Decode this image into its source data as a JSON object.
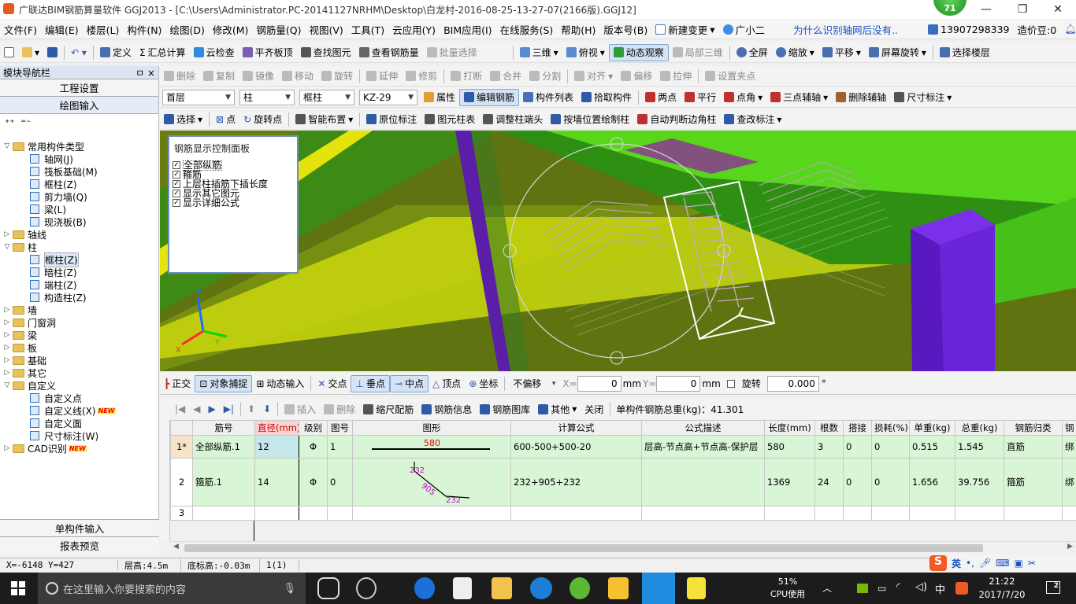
{
  "title": {
    "text": "广联达BIM钢筋算量软件 GGJ2013 - [C:\\Users\\Administrator.PC-20141127NRHM\\Desktop\\白龙村-2016-08-25-13-27-07(2166版).GGJ12]",
    "badge": "71"
  },
  "menu": {
    "items": [
      "文件(F)",
      "编辑(E)",
      "楼层(L)",
      "构件(N)",
      "绘图(D)",
      "修改(M)",
      "钢筋量(Q)",
      "视图(V)",
      "工具(T)",
      "云应用(Y)",
      "BIM应用(I)",
      "在线服务(S)",
      "帮助(H)",
      "版本号(B)"
    ],
    "new_change": "新建变更",
    "guangxiaoer": "广小二",
    "help_link": "为什么识别轴网后没有..",
    "phone": "13907298339",
    "cost_bean": "造价豆:0"
  },
  "toolbar1": {
    "define": "定义",
    "sum": "汇总计算",
    "cloud_check": "云检查",
    "align_slab": "平齐板顶",
    "find_elem": "查找图元",
    "view_rebar": "查看钢筋量",
    "batch_select": "批量选择",
    "view3d": "三维",
    "top_view": "俯视",
    "dynamic_view": "动态观察",
    "local3d": "局部三维",
    "fullscreen": "全屏",
    "zoom": "缩放",
    "pan": "平移",
    "rotate_screen": "屏幕旋转",
    "select_floor": "选择楼层"
  },
  "toolbar2": {
    "delete": "删除",
    "copy": "复制",
    "mirror": "镜像",
    "move": "移动",
    "rotate": "旋转",
    "extend": "延伸",
    "trim": "修剪",
    "break": "打断",
    "merge": "合并",
    "split": "分割",
    "align": "对齐",
    "offset": "偏移",
    "stretch": "拉伸",
    "set_grip": "设置夹点"
  },
  "toolbar3": {
    "floor": "首层",
    "type": "柱",
    "subtype": "框柱",
    "element": "KZ-29",
    "property": "属性",
    "edit_rebar": "编辑钢筋",
    "elem_list": "构件列表",
    "pick_elem": "拾取构件",
    "two_point": "两点",
    "parallel": "平行",
    "point_angle": "点角",
    "three_point_aux": "三点辅轴",
    "del_aux": "删除辅轴",
    "dimension": "尺寸标注"
  },
  "toolbar4": {
    "select": "选择",
    "point": "点",
    "rotate_point": "旋转点",
    "smart_layout": "智能布置",
    "origin_label": "原位标注",
    "elem_col_table": "图元柱表",
    "adjust_col_end": "调整柱端头",
    "draw_by_wall": "按墙位置绘制柱",
    "auto_corner": "自动判断边角柱",
    "change_label": "查改标注"
  },
  "nav": {
    "title": "模块导航栏",
    "pin": "ㅁ ×",
    "project_settings": "工程设置",
    "draw_input": "绘图输入",
    "single_input": "单构件输入",
    "report_preview": "报表预览",
    "tree": [
      {
        "label": "常用构件类型",
        "level": 0,
        "kind": "folder",
        "exp": "▽"
      },
      {
        "label": "轴网(J)",
        "level": 1,
        "kind": "item"
      },
      {
        "label": "筏板基础(M)",
        "level": 1,
        "kind": "item"
      },
      {
        "label": "框柱(Z)",
        "level": 1,
        "kind": "item"
      },
      {
        "label": "剪力墙(Q)",
        "level": 1,
        "kind": "item"
      },
      {
        "label": "梁(L)",
        "level": 1,
        "kind": "item"
      },
      {
        "label": "现浇板(B)",
        "level": 1,
        "kind": "item"
      },
      {
        "label": "轴线",
        "level": 0,
        "kind": "folder",
        "exp": "▷"
      },
      {
        "label": "柱",
        "level": 0,
        "kind": "folder",
        "exp": "▽"
      },
      {
        "label": "框柱(Z)",
        "level": 1,
        "kind": "item",
        "hl": true
      },
      {
        "label": "暗柱(Z)",
        "level": 1,
        "kind": "item"
      },
      {
        "label": "端柱(Z)",
        "level": 1,
        "kind": "item"
      },
      {
        "label": "构造柱(Z)",
        "level": 1,
        "kind": "item"
      },
      {
        "label": "墙",
        "level": 0,
        "kind": "folder",
        "exp": "▷"
      },
      {
        "label": "门窗洞",
        "level": 0,
        "kind": "folder",
        "exp": "▷"
      },
      {
        "label": "梁",
        "level": 0,
        "kind": "folder",
        "exp": "▷"
      },
      {
        "label": "板",
        "level": 0,
        "kind": "folder",
        "exp": "▷"
      },
      {
        "label": "基础",
        "level": 0,
        "kind": "folder",
        "exp": "▷"
      },
      {
        "label": "其它",
        "level": 0,
        "kind": "folder",
        "exp": "▷"
      },
      {
        "label": "自定义",
        "level": 0,
        "kind": "folder",
        "exp": "▽"
      },
      {
        "label": "自定义点",
        "level": 1,
        "kind": "item"
      },
      {
        "label": "自定义线(X)",
        "level": 1,
        "kind": "item",
        "new": true
      },
      {
        "label": "自定义面",
        "level": 1,
        "kind": "item"
      },
      {
        "label": "尺寸标注(W)",
        "level": 1,
        "kind": "item"
      },
      {
        "label": "CAD识别",
        "level": 0,
        "kind": "folder",
        "exp": "▷",
        "new": true
      }
    ],
    "new_text": "NEW"
  },
  "ctrl_panel": {
    "title": "钢筋显示控制面板",
    "options": [
      "全部纵筋",
      "箍筋",
      "上层柱插筋下插长度",
      "显示其它图元",
      "显示详细公式"
    ]
  },
  "snap": {
    "ortho": "正交",
    "obj_snap": "对象捕捉",
    "dyn_input": "动态输入",
    "intersect": "交点",
    "perp": "垂点",
    "mid": "中点",
    "vertex": "顶点",
    "coord": "坐标",
    "offset_mode": "不偏移",
    "x_label": "X=",
    "x_val": "0",
    "y_label": "Y=",
    "y_val": "0",
    "unit": "mm",
    "rotate": "旋转",
    "rotate_val": "0.000",
    "deg": "°"
  },
  "grid_toolbar": {
    "insert": "插入",
    "delete": "删除",
    "scale_rebar": "缩尺配筋",
    "rebar_info": "钢筋信息",
    "rebar_lib": "钢筋图库",
    "other": "其他",
    "close": "关闭",
    "total": "单构件钢筋总重(kg)：41.301"
  },
  "grid": {
    "headers": [
      "",
      "筋号",
      "直径(mm)",
      "级别",
      "图号",
      "图形",
      "计算公式",
      "公式描述",
      "长度(mm)",
      "根数",
      "搭接",
      "损耗(%)",
      "单重(kg)",
      "总重(kg)",
      "钢筋归类",
      "钢"
    ],
    "rows": [
      [
        "1*",
        "全部纵筋.1",
        "12",
        "Φ",
        "1",
        "580",
        "600-500+500-20",
        "层高-节点高+节点高-保护层",
        "580",
        "3",
        "0",
        "0",
        "0.515",
        "1.545",
        "直筋",
        "绑"
      ],
      [
        "2",
        "箍筋.1",
        "14",
        "Φ",
        "0",
        "",
        "232+905+232",
        "",
        "1369",
        "24",
        "0",
        "0",
        "1.656",
        "39.756",
        "箍筋",
        "绑"
      ],
      [
        "3",
        "",
        "",
        "",
        "",
        "",
        "",
        "",
        "",
        "",
        "",
        "",
        "",
        "",
        "",
        ""
      ]
    ],
    "shape2_labels": [
      "232",
      "905",
      "232"
    ]
  },
  "status": {
    "coords": "X=-6148 Y=427",
    "floor_height": "层高:4.5m",
    "base_height": "底标高:-0.03m",
    "count": "1(1)"
  },
  "taskbar": {
    "search_placeholder": "在这里输入你要搜索的内容",
    "cpu_pct": "51%",
    "cpu_label": "CPU使用",
    "ime_lang": "中",
    "ime_en": "英",
    "time": "21:22",
    "date": "2017/7/20",
    "notif": "2"
  }
}
